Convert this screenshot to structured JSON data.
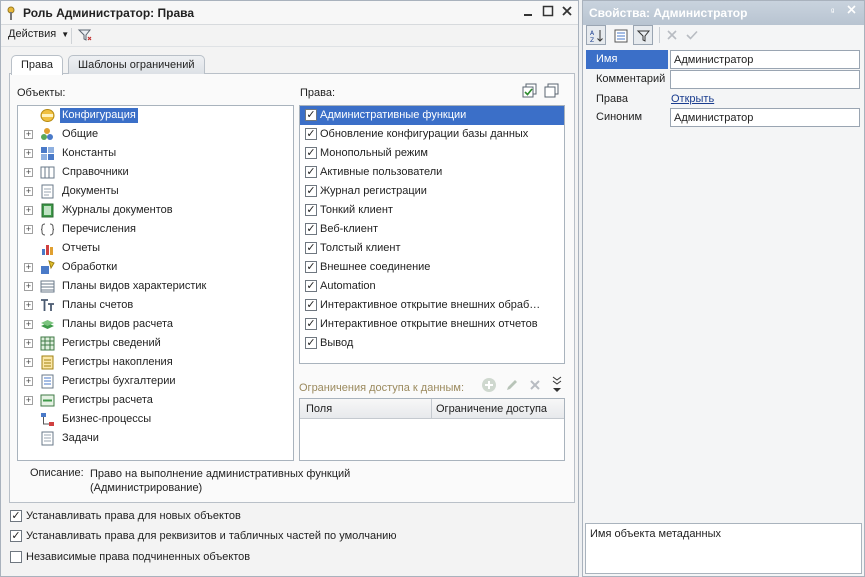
{
  "left_window": {
    "title": "Роль Администратор: Права",
    "actions_label": "Действия",
    "tabs": [
      "Права",
      "Шаблоны ограничений"
    ],
    "objects_label": "Объекты:",
    "rights_label": "Права:",
    "tree": [
      {
        "label": "Конфигурация",
        "icon": "config-icon",
        "expandable": false,
        "selected": true
      },
      {
        "label": "Общие",
        "icon": "common-icon",
        "expandable": true
      },
      {
        "label": "Константы",
        "icon": "constants-icon",
        "expandable": true
      },
      {
        "label": "Справочники",
        "icon": "catalogs-icon",
        "expandable": true
      },
      {
        "label": "Документы",
        "icon": "documents-icon",
        "expandable": true
      },
      {
        "label": "Журналы документов",
        "icon": "journals-icon",
        "expandable": true
      },
      {
        "label": "Перечисления",
        "icon": "enums-icon",
        "expandable": true
      },
      {
        "label": "Отчеты",
        "icon": "reports-icon",
        "expandable": false
      },
      {
        "label": "Обработки",
        "icon": "dataprocessors-icon",
        "expandable": true
      },
      {
        "label": "Планы видов характеристик",
        "icon": "chart-char-types-icon",
        "expandable": true
      },
      {
        "label": "Планы счетов",
        "icon": "chart-accounts-icon",
        "expandable": true
      },
      {
        "label": "Планы видов расчета",
        "icon": "chart-calc-types-icon",
        "expandable": true
      },
      {
        "label": "Регистры сведений",
        "icon": "info-registers-icon",
        "expandable": true
      },
      {
        "label": "Регистры накопления",
        "icon": "accum-registers-icon",
        "expandable": true
      },
      {
        "label": "Регистры бухгалтерии",
        "icon": "acc-registers-icon",
        "expandable": true
      },
      {
        "label": "Регистры расчета",
        "icon": "calc-registers-icon",
        "expandable": true
      },
      {
        "label": "Бизнес-процессы",
        "icon": "business-processes-icon",
        "expandable": false
      },
      {
        "label": "Задачи",
        "icon": "tasks-icon",
        "expandable": false
      }
    ],
    "rights": [
      {
        "label": "Административные функции",
        "checked": true,
        "selected": true
      },
      {
        "label": "Обновление конфигурации базы данных",
        "checked": true
      },
      {
        "label": "Монопольный режим",
        "checked": true
      },
      {
        "label": "Активные пользователи",
        "checked": true
      },
      {
        "label": "Журнал регистрации",
        "checked": true
      },
      {
        "label": "Тонкий клиент",
        "checked": true
      },
      {
        "label": "Веб-клиент",
        "checked": true
      },
      {
        "label": "Толстый клиент",
        "checked": true
      },
      {
        "label": "Внешнее соединение",
        "checked": true
      },
      {
        "label": "Automation",
        "checked": true
      },
      {
        "label": "Интерактивное открытие внешних обраб…",
        "checked": true
      },
      {
        "label": "Интерактивное открытие внешних отчетов",
        "checked": true
      },
      {
        "label": "Вывод",
        "checked": true
      }
    ],
    "restrictions_label": "Ограничения доступа к данным:",
    "restrictions_columns": [
      "Поля",
      "Ограничение доступа"
    ],
    "description_label": "Описание:",
    "description_text": "Право на выполнение административных функций (Администрирование)",
    "options": [
      {
        "label": "Устанавливать права для новых объектов",
        "checked": true
      },
      {
        "label": "Устанавливать права для реквизитов и табличных частей по умолчанию",
        "checked": true
      },
      {
        "label": "Независимые права подчиненных объектов",
        "checked": false
      }
    ]
  },
  "right_window": {
    "title": "Свойства: Администратор",
    "properties": {
      "name_label": "Имя",
      "name_value": "Администратор",
      "comment_label": "Комментарий",
      "comment_value": "",
      "rights_label": "Права",
      "rights_link": "Открыть",
      "synonym_label": "Синоним",
      "synonym_value": "Администратор"
    },
    "help_text": "Имя объекта метаданных"
  },
  "colors": {
    "selection": "#3b6fc8",
    "title_right_bg": "#c0cad6"
  }
}
